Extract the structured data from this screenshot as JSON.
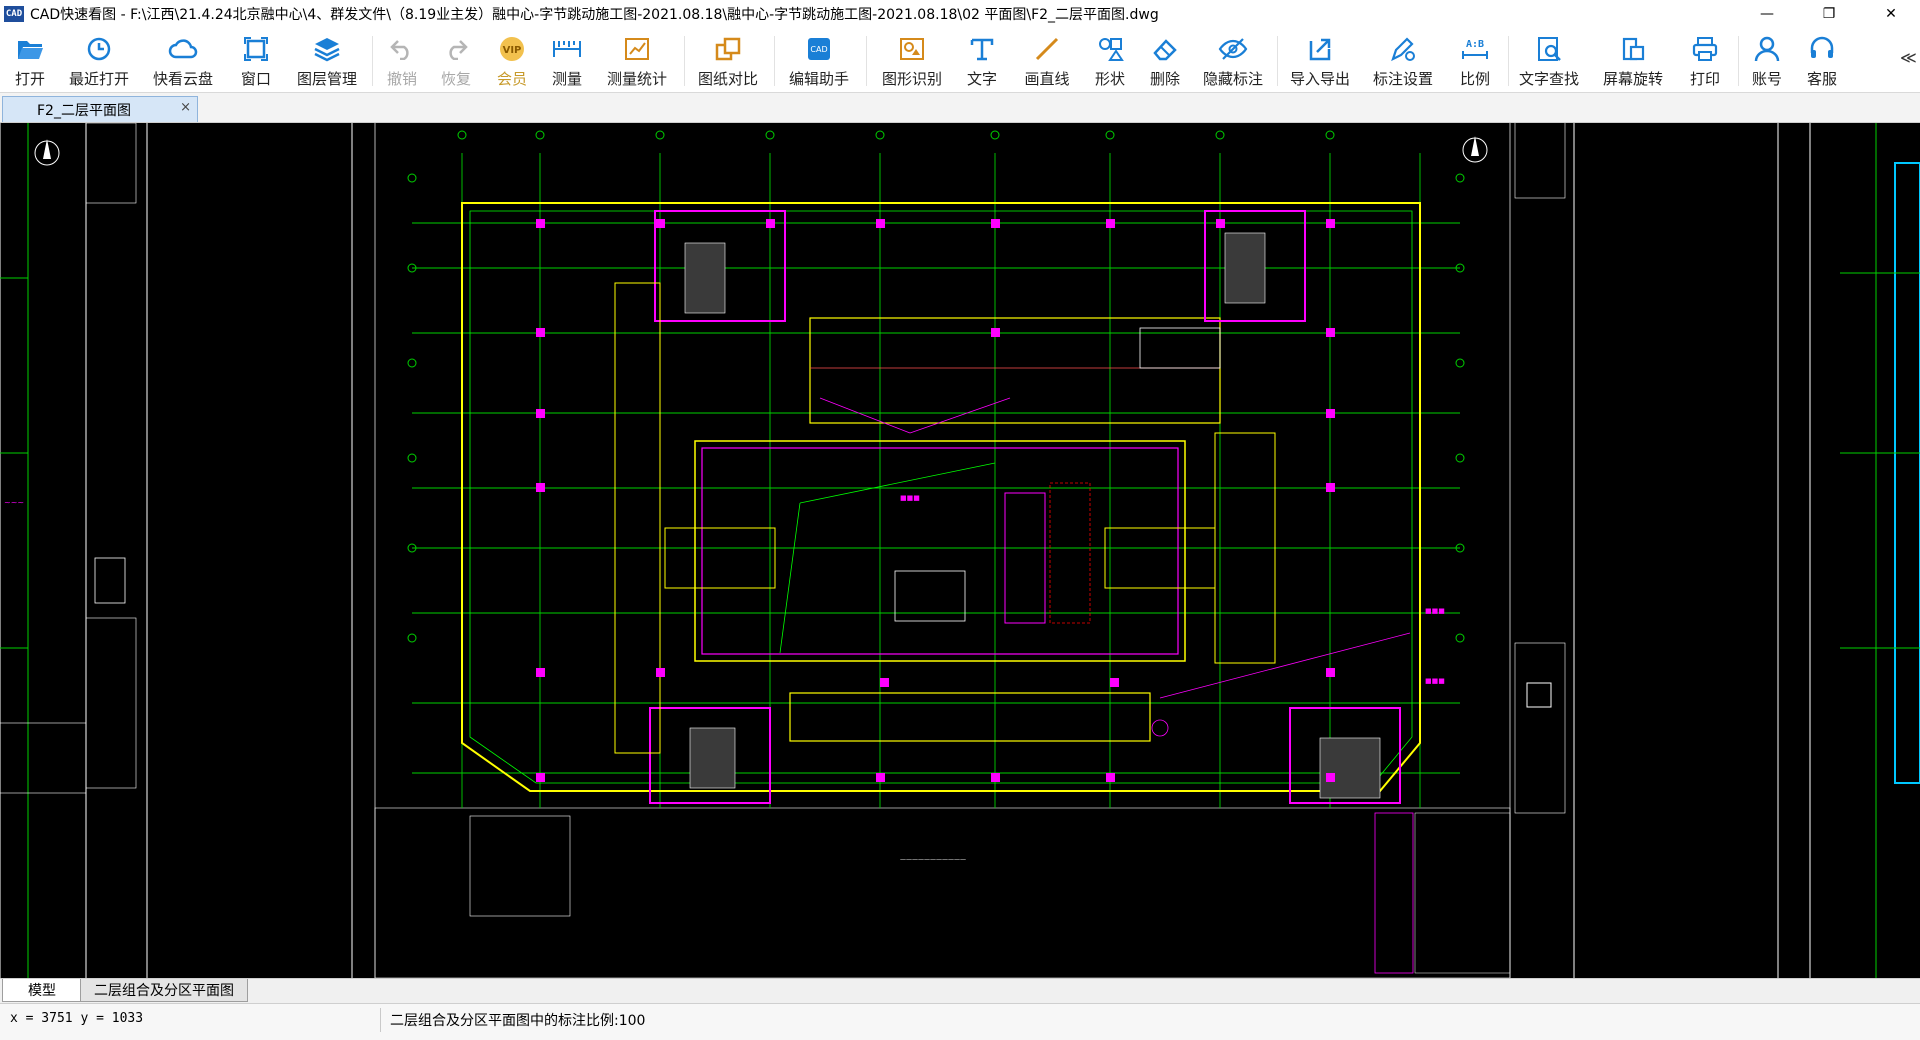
{
  "window": {
    "app_icon_text": "CAD",
    "title": "CAD快速看图 - F:\\江西\\21.4.24北京融中心\\4、群发文件\\（8.19业主发）融中心-字节跳动施工图-2021.08.18\\融中心-字节跳动施工图-2021.08.18\\02 平面图\\F2_二层平面图.dwg",
    "minimize": "—",
    "maximize": "❐",
    "close": "✕"
  },
  "toolbar": {
    "items": [
      {
        "id": "open",
        "label": "打开",
        "icon": "folder-open-icon"
      },
      {
        "id": "recent",
        "label": "最近打开",
        "icon": "clock-icon"
      },
      {
        "id": "cloud",
        "label": "快看云盘",
        "icon": "cloud-icon"
      },
      {
        "id": "window",
        "label": "窗口",
        "icon": "window-icon"
      },
      {
        "id": "layers",
        "label": "图层管理",
        "icon": "layers-icon"
      },
      {
        "id": "undo",
        "label": "撤销",
        "icon": "undo-icon"
      },
      {
        "id": "redo",
        "label": "恢复",
        "icon": "redo-icon"
      },
      {
        "id": "vip",
        "label": "会员",
        "icon": "vip-icon"
      },
      {
        "id": "measure",
        "label": "测量",
        "icon": "ruler-icon"
      },
      {
        "id": "measure_stats",
        "label": "测量统计",
        "icon": "chart-ruler-icon"
      },
      {
        "id": "compare",
        "label": "图纸对比",
        "icon": "compare-icon"
      },
      {
        "id": "edit_helper",
        "label": "编辑助手",
        "icon": "edit-doc-icon"
      },
      {
        "id": "shape_recog",
        "label": "图形识别",
        "icon": "shape-recognize-icon"
      },
      {
        "id": "text",
        "label": "文字",
        "icon": "text-t-icon"
      },
      {
        "id": "line",
        "label": "画直线",
        "icon": "line-icon"
      },
      {
        "id": "shape",
        "label": "形状",
        "icon": "shape-icon"
      },
      {
        "id": "delete",
        "label": "删除",
        "icon": "eraser-icon"
      },
      {
        "id": "hide_annot",
        "label": "隐藏标注",
        "icon": "eye-off-icon"
      },
      {
        "id": "import_export",
        "label": "导入导出",
        "icon": "export-icon"
      },
      {
        "id": "annot_settings",
        "label": "标注设置",
        "icon": "pen-gear-icon"
      },
      {
        "id": "scale",
        "label": "比例",
        "icon": "scale-ab-icon"
      },
      {
        "id": "text_search",
        "label": "文字查找",
        "icon": "text-search-icon"
      },
      {
        "id": "rotate",
        "label": "屏幕旋转",
        "icon": "rotate-screen-icon"
      },
      {
        "id": "print",
        "label": "打印",
        "icon": "printer-icon"
      },
      {
        "id": "account",
        "label": "账号",
        "icon": "user-icon"
      },
      {
        "id": "support",
        "label": "客服",
        "icon": "headset-icon"
      }
    ],
    "more": "≪",
    "accent_color": "#1a7fd6"
  },
  "document_tab": {
    "label": "F2_二层平面图",
    "close": "×"
  },
  "layout_tabs": {
    "model": "模型",
    "layout": "二层组合及分区平面图"
  },
  "status": {
    "coords": "x = 3751  y = 1033",
    "scale_info": "二层组合及分区平面图中的标注比例:100"
  }
}
